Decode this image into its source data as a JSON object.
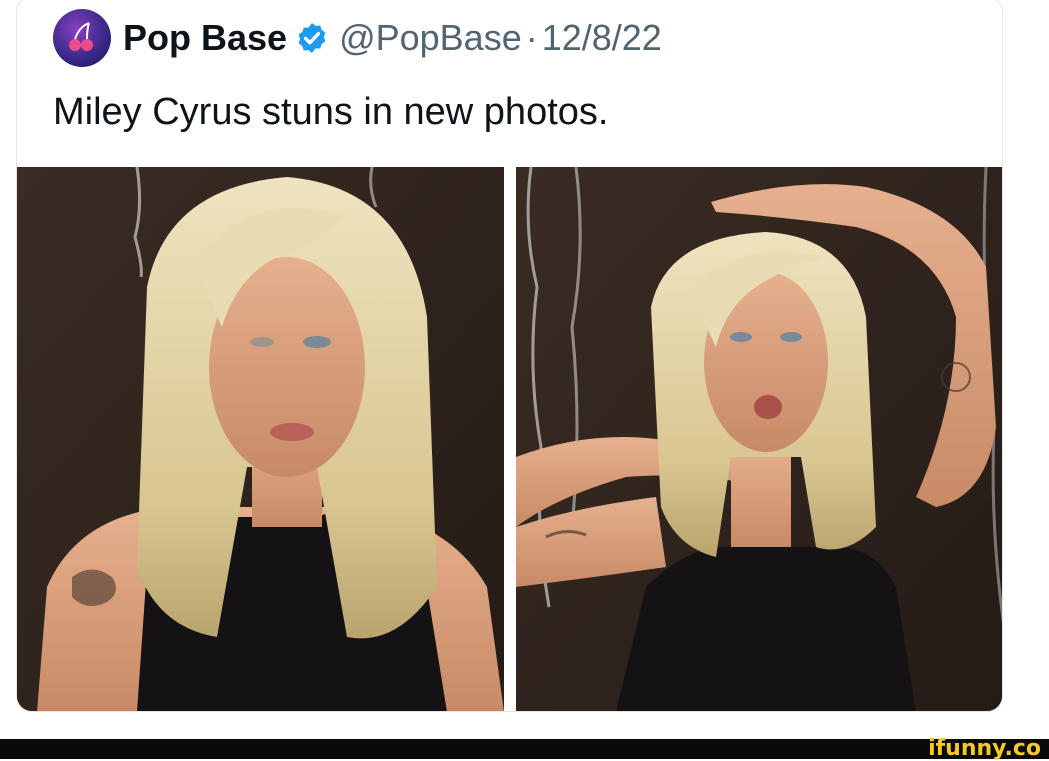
{
  "tweet": {
    "name": "Pop Base",
    "handle": "@PopBase",
    "separator": "·",
    "date": "12/8/22",
    "text": "Miley Cyrus stuns in new photos.",
    "verified_icon": "verified-badge-icon",
    "avatar_icon": "pop-base-logo"
  },
  "photos": [
    {
      "name": "photo-left"
    },
    {
      "name": "photo-right"
    }
  ],
  "watermark": "ifunny.co",
  "colors": {
    "verified": "#1d9bf0",
    "watermark": "#f6c927",
    "footer_bar": "#0a0a0a",
    "text": "#0f1419",
    "secondary_text": "#536471"
  }
}
